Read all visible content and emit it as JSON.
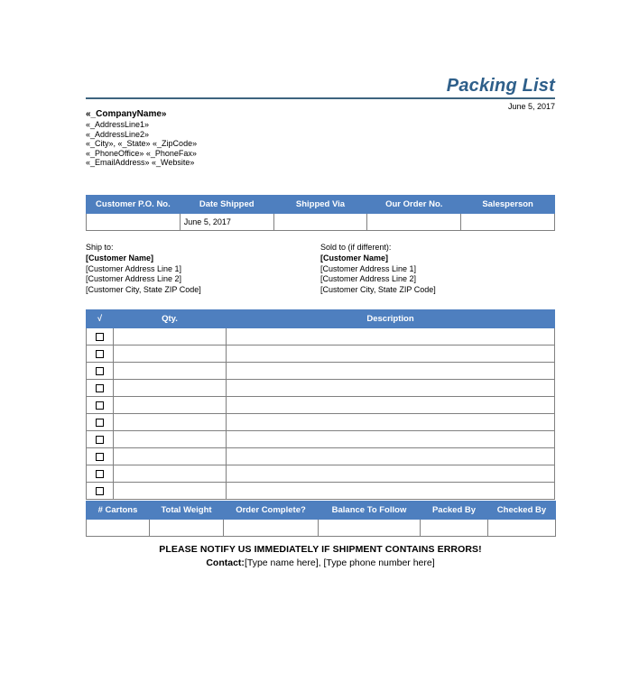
{
  "document": {
    "title": "Packing List",
    "date": "June 5, 2017"
  },
  "company": {
    "name": "«_CompanyName»",
    "address_line_1": "«_AddressLine1»",
    "address_line_2": "«_AddressLine2»",
    "city_state_zip": "«_City», «_State» «_ZipCode»",
    "phone_fax": "«_PhoneOffice» «_PhoneFax»",
    "email_website": "«_EmailAddress» «_Website»"
  },
  "order_table": {
    "headers": [
      "Customer P.O. No.",
      "Date Shipped",
      "Shipped Via",
      "Our Order No.",
      "Salesperson"
    ],
    "row": [
      "",
      "June 5, 2017",
      "",
      "",
      ""
    ]
  },
  "ship_to": {
    "label": "Ship to:",
    "name": "[Customer Name]",
    "address_line_1": "[Customer Address Line 1]",
    "address_line_2": "[Customer Address Line 2]",
    "city_state_zip": "[Customer City, State ZIP Code]"
  },
  "sold_to": {
    "label": "Sold to (if different):",
    "name": "[Customer Name]",
    "address_line_1": "[Customer Address Line 1]",
    "address_line_2": "[Customer Address Line 2]",
    "city_state_zip": "[Customer City, State ZIP Code]"
  },
  "items_table": {
    "headers": [
      "√",
      "Qty.",
      "Description"
    ],
    "rows": [
      {
        "checked": false,
        "qty": "",
        "description": ""
      },
      {
        "checked": false,
        "qty": "",
        "description": ""
      },
      {
        "checked": false,
        "qty": "",
        "description": ""
      },
      {
        "checked": false,
        "qty": "",
        "description": ""
      },
      {
        "checked": false,
        "qty": "",
        "description": ""
      },
      {
        "checked": false,
        "qty": "",
        "description": ""
      },
      {
        "checked": false,
        "qty": "",
        "description": ""
      },
      {
        "checked": false,
        "qty": "",
        "description": ""
      },
      {
        "checked": false,
        "qty": "",
        "description": ""
      },
      {
        "checked": false,
        "qty": "",
        "description": ""
      }
    ]
  },
  "summary_table": {
    "headers": [
      "# Cartons",
      "Total Weight",
      "Order Complete?",
      "Balance To Follow",
      "Packed By",
      "Checked By"
    ],
    "row": [
      "",
      "",
      "",
      "",
      "",
      ""
    ]
  },
  "footer": {
    "notice": "PLEASE NOTIFY US IMMEDIATELY IF SHIPMENT CONTAINS ERRORS!",
    "contact_label": "Contact:",
    "contact_value": "[Type name here], [Type phone number here]"
  },
  "colors": {
    "header_blue": "#4e7fbf",
    "title_blue": "#2e5f8a",
    "rule_blue": "#3d647f",
    "border_gray": "#808080"
  }
}
